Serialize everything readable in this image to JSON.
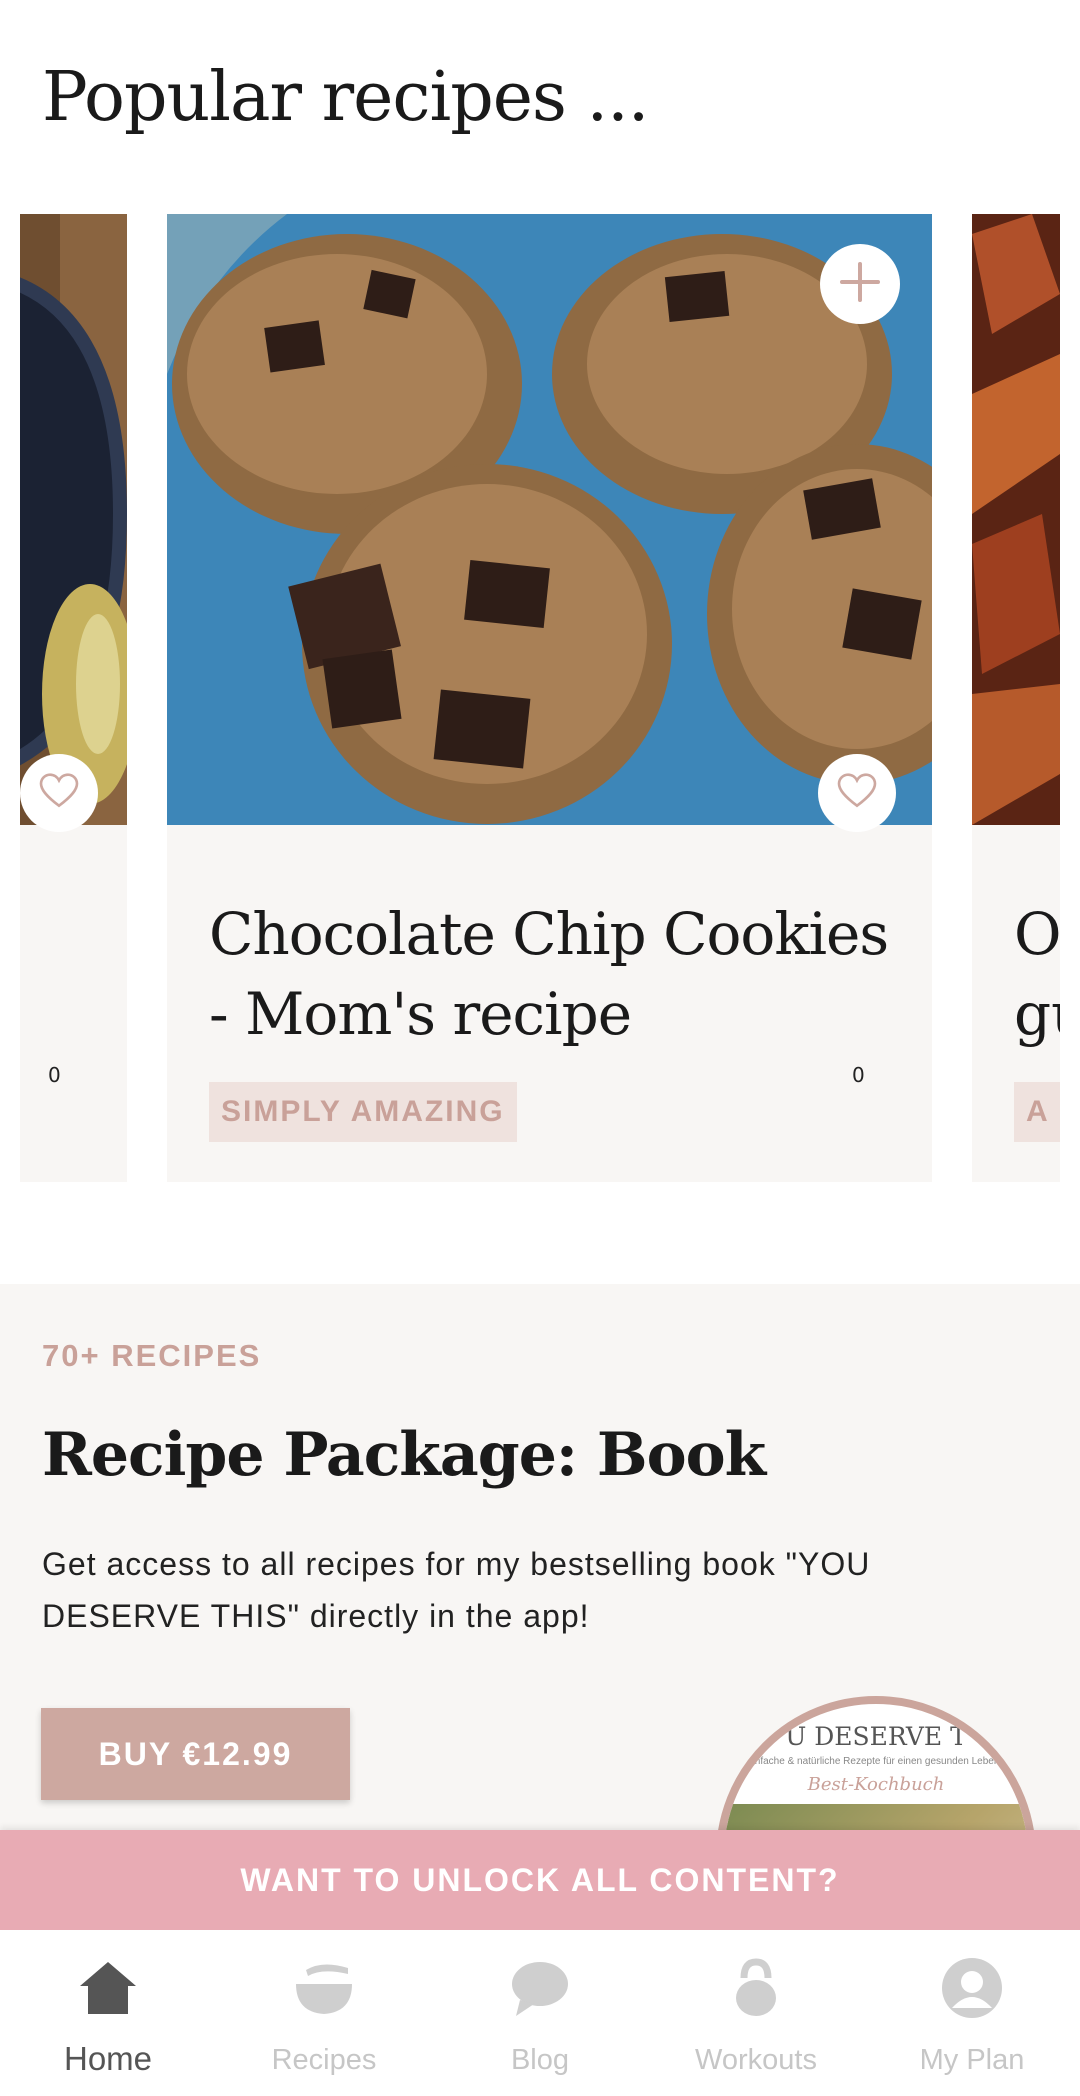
{
  "header": {
    "title": "Popular recipes ..."
  },
  "carousel": {
    "left_card": {
      "likes": "0",
      "image_icon": "pan-spoon-photo"
    },
    "main_card": {
      "image_icon": "chocolate-chip-cookies-photo",
      "likes": "0",
      "title": "Chocolate Chip Cookies - Mom's recipe",
      "tag": "SIMPLY AMAZING",
      "add_icon": "plus-icon",
      "like_icon": "heart-icon"
    },
    "right_card": {
      "title_peek": "O\ngu",
      "tag_peek": "A",
      "image_icon": "sweet-potato-fries-photo"
    }
  },
  "package": {
    "eyebrow": "70+ RECIPES",
    "title": "Recipe Package: Book",
    "description": "Get access to all recipes for my bestselling book \"YOU DESERVE THIS\" directly in the app!",
    "buy_label": "BUY €12.99",
    "book_title": "U DESERVE T",
    "book_subtitle": "infache & natürliche Rezepte für einen gesunden Leben",
    "book_script": "Best-Kochbuch"
  },
  "unlock_banner": {
    "label": "WANT TO UNLOCK ALL CONTENT?"
  },
  "bottom_nav": {
    "items": [
      {
        "label": "Home",
        "icon": "home-icon",
        "active": true
      },
      {
        "label": "Recipes",
        "icon": "bowl-whisk-icon",
        "active": false
      },
      {
        "label": "Blog",
        "icon": "chat-bubble-icon",
        "active": false
      },
      {
        "label": "Workouts",
        "icon": "kettlebell-icon",
        "active": false
      },
      {
        "label": "My Plan",
        "icon": "user-icon",
        "active": false
      }
    ]
  },
  "colors": {
    "accent": "#cda8a0",
    "tag_bg": "#efe2de",
    "tag_text": "#c9a199",
    "unlock_bar": "#e8abb4",
    "nav_inactive": "#c6c6c6",
    "nav_active": "#555555"
  }
}
